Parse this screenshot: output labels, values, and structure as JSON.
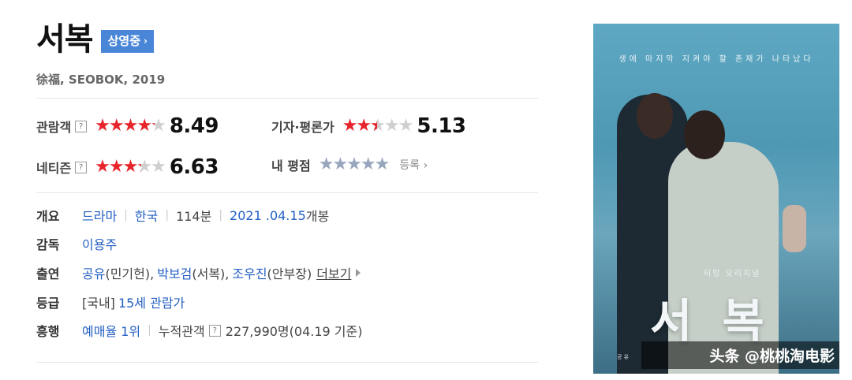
{
  "movie": {
    "title": "서복",
    "status_badge": "상영중",
    "subtitle": "徐福, SEOBOK, 2019"
  },
  "ratings": {
    "audience": {
      "label": "관람객",
      "stars": 4.25,
      "score": "8.49"
    },
    "critic": {
      "label": "기자·평론가",
      "stars": 2.5,
      "score": "5.13"
    },
    "netizen": {
      "label": "네티즌",
      "stars": 3.3,
      "score": "6.63"
    },
    "mine": {
      "label": "내 평점",
      "stars": 0,
      "register_label": "등록"
    },
    "help_glyph": "?"
  },
  "info": {
    "overview": {
      "key": "개요",
      "genre": "드라마",
      "country": "한국",
      "runtime": "114분",
      "release_date": "2021 .04.15",
      "release_suffix": "개봉"
    },
    "director": {
      "key": "감독",
      "name": "이용주"
    },
    "cast": {
      "key": "출연",
      "actors": [
        {
          "name": "공유",
          "role": "(민기헌),"
        },
        {
          "name": "박보검",
          "role": "(서복),"
        },
        {
          "name": "조우진",
          "role": "(안부장)"
        }
      ],
      "more_label": "더보기"
    },
    "rating_grade": {
      "key": "등급",
      "region": "[국내]",
      "grade": "15세 관람가"
    },
    "box_office": {
      "key": "흥행",
      "rank": "예매율 1위",
      "cumulative_label": "누적관객",
      "cumulative_value": "227,990명",
      "basis": "(04.19 기준)"
    }
  },
  "poster": {
    "tagline": "생애 마지막 지켜야 할 존재가 나타났다",
    "small_text": "티빙 오리지널",
    "big_title": "서복",
    "credit": "공 유",
    "watermark": "头条 @桃桃淘电影"
  },
  "colors": {
    "star_filled": "#e8242b",
    "star_empty": "#cfcfcf",
    "star_mine": "#98a6bd",
    "link": "#2460c4",
    "badge": "#4a86d8"
  },
  "icons": {
    "star": "★",
    "badge_chevron": "›",
    "register_chevron": "›"
  }
}
